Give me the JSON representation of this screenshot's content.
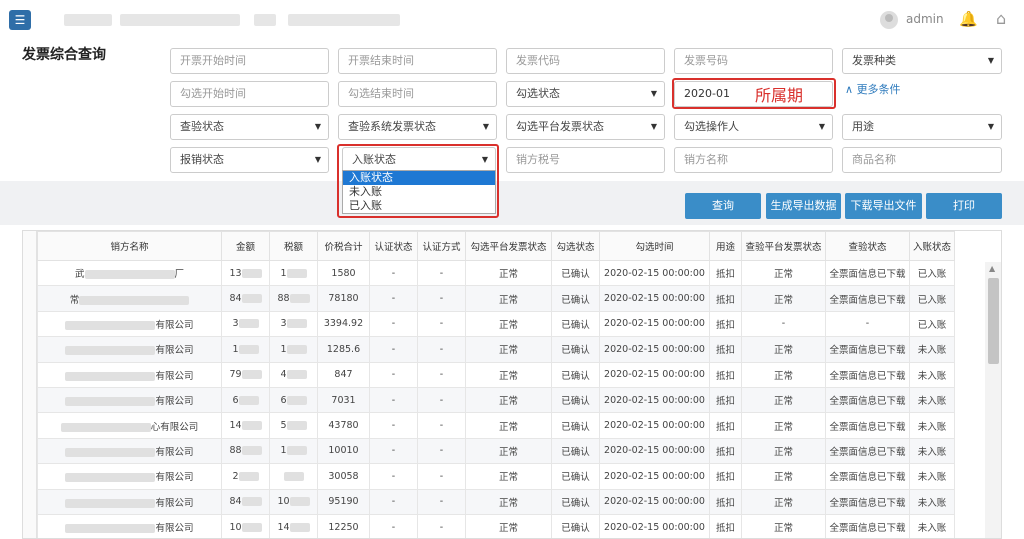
{
  "header": {
    "user": "admin"
  },
  "page_title": "发票综合查询",
  "filters": {
    "row1": [
      "开票开始时间",
      "开票结束时间",
      "发票代码",
      "发票号码",
      "发票种类"
    ],
    "row2": [
      "勾选开始时间",
      "勾选结束时间",
      "勾选状态",
      "2020-01"
    ],
    "row3": [
      "查验状态",
      "查验系统发票状态",
      "勾选平台发票状态",
      "勾选操作人",
      "用途"
    ],
    "row4": [
      "报销状态",
      "入账状态",
      "销方税号",
      "销方名称",
      "商品名称"
    ]
  },
  "more_conditions": "更多条件",
  "annotation": "所属期",
  "dropdown_options": [
    "入账状态",
    "未入账",
    "已入账"
  ],
  "buttons": {
    "query": "查询",
    "generate": "生成导出数据",
    "download": "下载导出文件",
    "print": "打印"
  },
  "table": {
    "headers": [
      "销方名称",
      "金额",
      "税额",
      "价税合计",
      "认证状态",
      "认证方式",
      "勾选平台发票状态",
      "勾选状态",
      "勾选时间",
      "用途",
      "查验平台发票状态",
      "查验状态",
      "入账状态"
    ],
    "rows": [
      {
        "name_prefix": "武",
        "name_suffix": "厂",
        "amount": "13",
        "tax": "1",
        "total": "1580",
        "auth": "-",
        "auth_method": "-",
        "platform": "正常",
        "check_state": "已确认",
        "time": "2020-02-15 00:00:00",
        "use": "抵扣",
        "verify_platform": "正常",
        "verify": "全票面信息已下载",
        "entry": "已入账"
      },
      {
        "name_prefix": "常",
        "name_suffix": "",
        "amount": "84",
        "tax": "88",
        "total": "78180",
        "auth": "-",
        "auth_method": "-",
        "platform": "正常",
        "check_state": "已确认",
        "time": "2020-02-15 00:00:00",
        "use": "抵扣",
        "verify_platform": "正常",
        "verify": "全票面信息已下载",
        "entry": "已入账"
      },
      {
        "name_prefix": "",
        "name_suffix": "有限公司",
        "amount": "3",
        "tax": "3",
        "total": "3394.92",
        "auth": "-",
        "auth_method": "-",
        "platform": "正常",
        "check_state": "已确认",
        "time": "2020-02-15 00:00:00",
        "use": "抵扣",
        "verify_platform": "-",
        "verify": "-",
        "entry": "已入账"
      },
      {
        "name_prefix": "",
        "name_suffix": "有限公司",
        "amount": "1",
        "tax": "1",
        "total": "1285.6",
        "auth": "-",
        "auth_method": "-",
        "platform": "正常",
        "check_state": "已确认",
        "time": "2020-02-15 00:00:00",
        "use": "抵扣",
        "verify_platform": "正常",
        "verify": "全票面信息已下载",
        "entry": "未入账"
      },
      {
        "name_prefix": "",
        "name_suffix": "有限公司",
        "amount": "79",
        "tax": "4",
        "total": "847",
        "auth": "-",
        "auth_method": "-",
        "platform": "正常",
        "check_state": "已确认",
        "time": "2020-02-15 00:00:00",
        "use": "抵扣",
        "verify_platform": "正常",
        "verify": "全票面信息已下载",
        "entry": "未入账"
      },
      {
        "name_prefix": "",
        "name_suffix": "有限公司",
        "amount": "6",
        "tax": "6",
        "total": "7031",
        "auth": "-",
        "auth_method": "-",
        "platform": "正常",
        "check_state": "已确认",
        "time": "2020-02-15 00:00:00",
        "use": "抵扣",
        "verify_platform": "正常",
        "verify": "全票面信息已下载",
        "entry": "未入账"
      },
      {
        "name_prefix": "",
        "name_suffix": "心有限公司",
        "amount": "14",
        "tax": "5",
        "total": "43780",
        "auth": "-",
        "auth_method": "-",
        "platform": "正常",
        "check_state": "已确认",
        "time": "2020-02-15 00:00:00",
        "use": "抵扣",
        "verify_platform": "正常",
        "verify": "全票面信息已下载",
        "entry": "未入账"
      },
      {
        "name_prefix": "",
        "name_suffix": "有限公司",
        "amount": "88",
        "tax": "1",
        "total": "10010",
        "auth": "-",
        "auth_method": "-",
        "platform": "正常",
        "check_state": "已确认",
        "time": "2020-02-15 00:00:00",
        "use": "抵扣",
        "verify_platform": "正常",
        "verify": "全票面信息已下载",
        "entry": "未入账"
      },
      {
        "name_prefix": "",
        "name_suffix": "有限公司",
        "amount": "2",
        "tax": "",
        "total": "30058",
        "auth": "-",
        "auth_method": "-",
        "platform": "正常",
        "check_state": "已确认",
        "time": "2020-02-15 00:00:00",
        "use": "抵扣",
        "verify_platform": "正常",
        "verify": "全票面信息已下载",
        "entry": "未入账"
      },
      {
        "name_prefix": "",
        "name_suffix": "有限公司",
        "amount": "84",
        "tax": "10",
        "total": "95190",
        "auth": "-",
        "auth_method": "-",
        "platform": "正常",
        "check_state": "已确认",
        "time": "2020-02-15 00:00:00",
        "use": "抵扣",
        "verify_platform": "正常",
        "verify": "全票面信息已下载",
        "entry": "未入账"
      },
      {
        "name_prefix": "",
        "name_suffix": "有限公司",
        "amount": "10",
        "tax": "14",
        "total": "12250",
        "auth": "-",
        "auth_method": "-",
        "platform": "正常",
        "check_state": "已确认",
        "time": "2020-02-15 00:00:00",
        "use": "抵扣",
        "verify_platform": "正常",
        "verify": "全票面信息已下载",
        "entry": "未入账"
      }
    ]
  },
  "colors": {
    "primary": "#3a8dc8",
    "highlight": "#d9302c",
    "menu": "#2f6ea8"
  },
  "icons": [
    "menu-icon",
    "avatar-icon",
    "bell-icon",
    "home-icon",
    "chevron-up-double-icon",
    "dropdown-arrow-icon"
  ]
}
